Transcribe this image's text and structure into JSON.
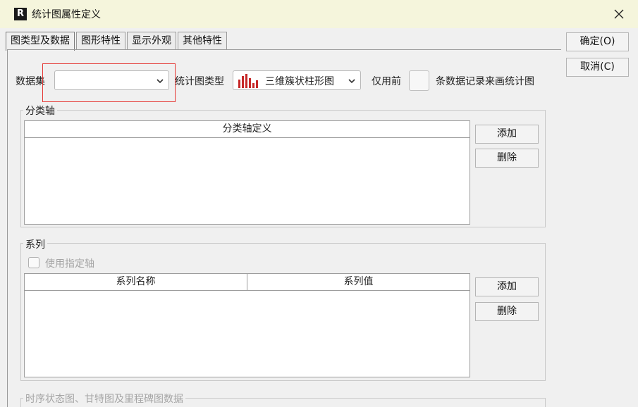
{
  "window": {
    "title": "统计图属性定义",
    "app_icon_glyph": "R"
  },
  "tabs": [
    {
      "label": "图类型及数据",
      "active": true
    },
    {
      "label": "图形特性",
      "active": false
    },
    {
      "label": "显示外观",
      "active": false
    },
    {
      "label": "其他特性",
      "active": false
    }
  ],
  "buttons": {
    "ok": "确定(O)",
    "cancel": "取消(C)"
  },
  "data_row": {
    "dataset_label": "数据集",
    "dataset_value": "",
    "chart_type_label": "统计图类型",
    "chart_type_value": "三维簇状柱形图",
    "only_first_label": "仅用前",
    "only_first_value": "",
    "records_suffix": "条数据记录来画统计图"
  },
  "category_axis": {
    "group_title": "分类轴",
    "column_header": "分类轴定义",
    "add_label": "添加",
    "delete_label": "删除"
  },
  "series": {
    "group_title": "系列",
    "use_axis_label": "使用指定轴",
    "columns": [
      "系列名称",
      "系列值"
    ],
    "add_label": "添加",
    "delete_label": "删除"
  },
  "timeline": {
    "group_title": "时序状态图、甘特图及里程碑图数据"
  },
  "colors": {
    "highlight": "#e53935",
    "chart_icon": "#c62828"
  }
}
